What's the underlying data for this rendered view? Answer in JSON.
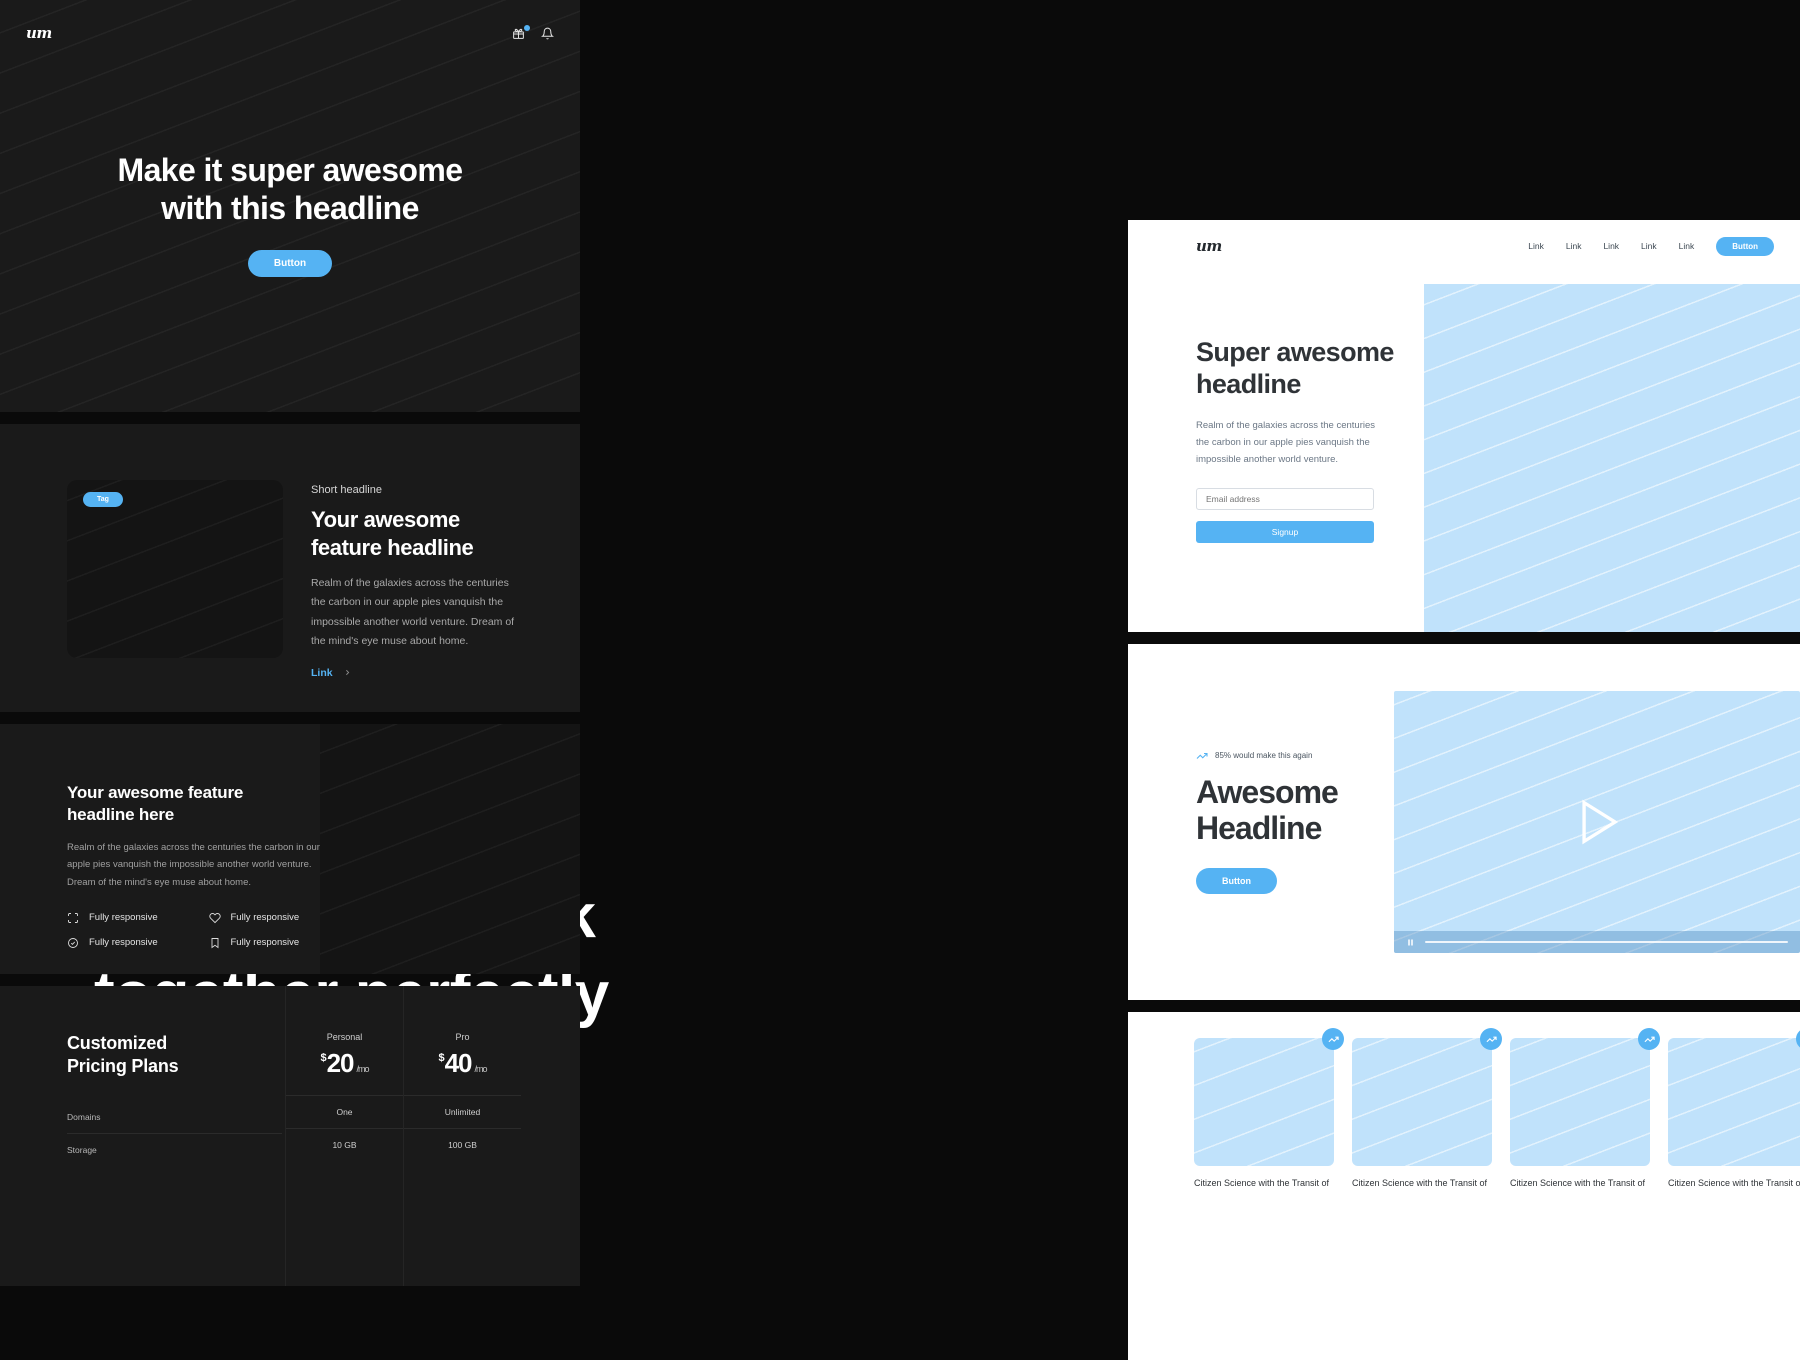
{
  "left_copy": {
    "headline": "Stack & snap layouts that work together perfectly"
  },
  "brand": {
    "logo": "um",
    "accent": "#55b3f3"
  },
  "dark_column": {
    "hero": {
      "logo": "um",
      "icons": [
        "gift-icon",
        "bell-icon"
      ],
      "headline": "Make it super awesome\nwith this headline",
      "button_label": "Button"
    },
    "feature_split": {
      "tag": "Tag",
      "eyebrow": "Short headline",
      "headline": "Your awesome\nfeature headline",
      "body": "Realm of the galaxies across the centuries the carbon in our apple pies vanquish the impossible another world venture. Dream of the mind's eye muse about home.",
      "link_label": "Link"
    },
    "feature_grid": {
      "headline": "Your awesome feature\nheadline here",
      "body": "Realm of the galaxies across the centuries the carbon in our apple pies vanquish the impossible another world venture. Dream of the mind's eye muse about home.",
      "items": [
        {
          "icon": "expand-icon",
          "label": "Fully responsive"
        },
        {
          "icon": "heart-icon",
          "label": "Fully responsive"
        },
        {
          "icon": "check-circle-icon",
          "label": "Fully responsive"
        },
        {
          "icon": "bookmark-icon",
          "label": "Fully responsive"
        }
      ]
    },
    "pricing": {
      "headline": "Customized\nPricing Plans",
      "rows": [
        "Domains",
        "Storage"
      ],
      "plans": [
        {
          "name": "Personal",
          "currency": "$",
          "price": "20",
          "period": "/mo",
          "cells": [
            "One",
            "10 GB"
          ]
        },
        {
          "name": "Pro",
          "currency": "$",
          "price": "40",
          "period": "/mo",
          "cells": [
            "Unlimited",
            "100 GB"
          ]
        }
      ]
    }
  },
  "signup_card": {
    "logo": "um",
    "nav_links": [
      "Link",
      "Link",
      "Link",
      "Link",
      "Link"
    ],
    "cta_label": "Button",
    "headline": "Super awesome\nheadline",
    "body": "Realm of the galaxies across the centuries the carbon in our apple pies vanquish the impossible another world venture.",
    "email_placeholder": "Email address",
    "signup_label": "Signup"
  },
  "video_card": {
    "stat_icon": "trending-up-icon",
    "stat_label": "85% would make this again",
    "headline": "Awesome\nHeadline",
    "button_label": "Button",
    "player": {
      "state_icon": "pause-icon"
    }
  },
  "gallery_card": {
    "items": [
      {
        "badge_icon": "trending-up-icon",
        "caption": "Citizen Science with the Transit of"
      },
      {
        "badge_icon": "trending-up-icon",
        "caption": "Citizen Science with the Transit of"
      },
      {
        "badge_icon": "trending-up-icon",
        "caption": "Citizen Science with the Transit of"
      },
      {
        "badge_icon": "trending-up-icon",
        "caption": "Citizen Science with the Transit of"
      }
    ]
  }
}
